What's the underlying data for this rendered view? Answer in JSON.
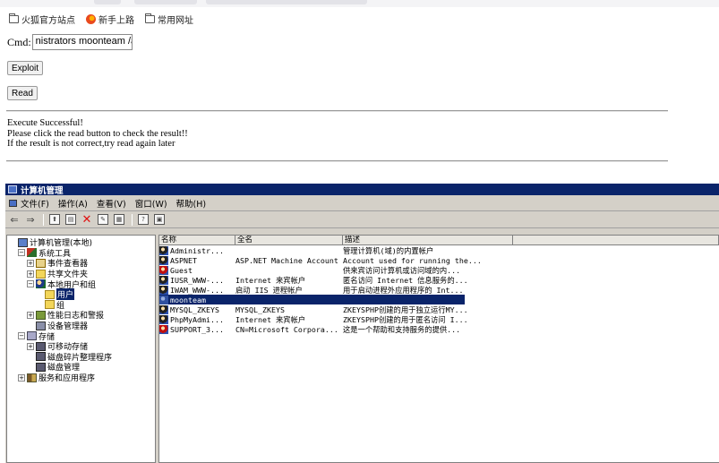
{
  "bookmarks": [
    {
      "label": "火狐官方站点",
      "icon": "folder-icon"
    },
    {
      "label": "新手上路",
      "icon": "firefox-icon"
    },
    {
      "label": "常用网址",
      "icon": "folder-icon"
    }
  ],
  "shell": {
    "cmd_label": "Cmd:",
    "cmd_value": "nistrators moonteam /a",
    "exploit_label": "Exploit",
    "read_label": "Read",
    "result_lines": [
      "Execute Successful!",
      "Please click the read button to check the result!!",
      "If the result is not correct,try read again later"
    ]
  },
  "mmc": {
    "title": "计算机管理",
    "menu": [
      "文件(F)",
      "操作(A)",
      "查看(V)",
      "窗口(W)",
      "帮助(H)"
    ],
    "tree": [
      {
        "label": "计算机管理(本地)",
        "icon": "computer-icon",
        "pm": "",
        "indent": 0
      },
      {
        "label": "系统工具",
        "icon": "tools-icon",
        "pm": "−",
        "indent": 1
      },
      {
        "label": "事件查看器",
        "icon": "event-viewer-icon",
        "pm": "+",
        "indent": 2
      },
      {
        "label": "共享文件夹",
        "icon": "shared-folder-icon",
        "pm": "+",
        "indent": 2
      },
      {
        "label": "本地用户和组",
        "icon": "users-groups-icon",
        "pm": "−",
        "indent": 2
      },
      {
        "label": "用户",
        "icon": "folder-icon",
        "pm": "",
        "indent": 3,
        "selected": true
      },
      {
        "label": "组",
        "icon": "folder-icon",
        "pm": "",
        "indent": 3
      },
      {
        "label": "性能日志和警报",
        "icon": "performance-icon",
        "pm": "+",
        "indent": 2
      },
      {
        "label": "设备管理器",
        "icon": "device-manager-icon",
        "pm": "",
        "indent": 2
      },
      {
        "label": "存储",
        "icon": "storage-icon",
        "pm": "−",
        "indent": 1
      },
      {
        "label": "可移动存储",
        "icon": "removable-storage-icon",
        "pm": "+",
        "indent": 2
      },
      {
        "label": "磁盘碎片整理程序",
        "icon": "defrag-icon",
        "pm": "",
        "indent": 2
      },
      {
        "label": "磁盘管理",
        "icon": "disk-management-icon",
        "pm": "",
        "indent": 2
      },
      {
        "label": "服务和应用程序",
        "icon": "services-icon",
        "pm": "+",
        "indent": 1
      }
    ],
    "columns": [
      "名称",
      "全名",
      "描述"
    ],
    "users": [
      {
        "name": "Administr...",
        "fullname": "",
        "desc": "管理计算机(域)的内置帐户",
        "icon": "user-icon"
      },
      {
        "name": "ASPNET",
        "fullname": "ASP.NET Machine Account",
        "desc": "Account used for running the...",
        "icon": "user-icon"
      },
      {
        "name": "Guest",
        "fullname": "",
        "desc": "供来宾访问计算机或访问域的内...",
        "icon": "user-disabled-icon"
      },
      {
        "name": "IUSR_WWW-...",
        "fullname": "Internet 来宾帐户",
        "desc": "匿名访问 Internet 信息服务的...",
        "icon": "user-icon"
      },
      {
        "name": "IWAM_WWW-...",
        "fullname": "启动 IIS 进程帐户",
        "desc": "用于启动进程外应用程序的 Int...",
        "icon": "user-icon"
      },
      {
        "name": "moonteam",
        "fullname": "",
        "desc": "",
        "icon": "user-icon",
        "selected": true
      },
      {
        "name": "MYSQL_ZKEYS",
        "fullname": "MYSQL_ZKEYS",
        "desc": "ZKEYSPHP创建的用于独立运行MY...",
        "icon": "user-icon"
      },
      {
        "name": "PhpMyAdmi...",
        "fullname": "Internet 来宾帐户",
        "desc": "ZKEYSPHP创建的用于匿名访问 I...",
        "icon": "user-icon"
      },
      {
        "name": "SUPPORT_3...",
        "fullname": "CN=Microsoft Corpora...",
        "desc": "这是一个帮助和支持服务的提供...",
        "icon": "user-disabled-icon"
      }
    ]
  }
}
